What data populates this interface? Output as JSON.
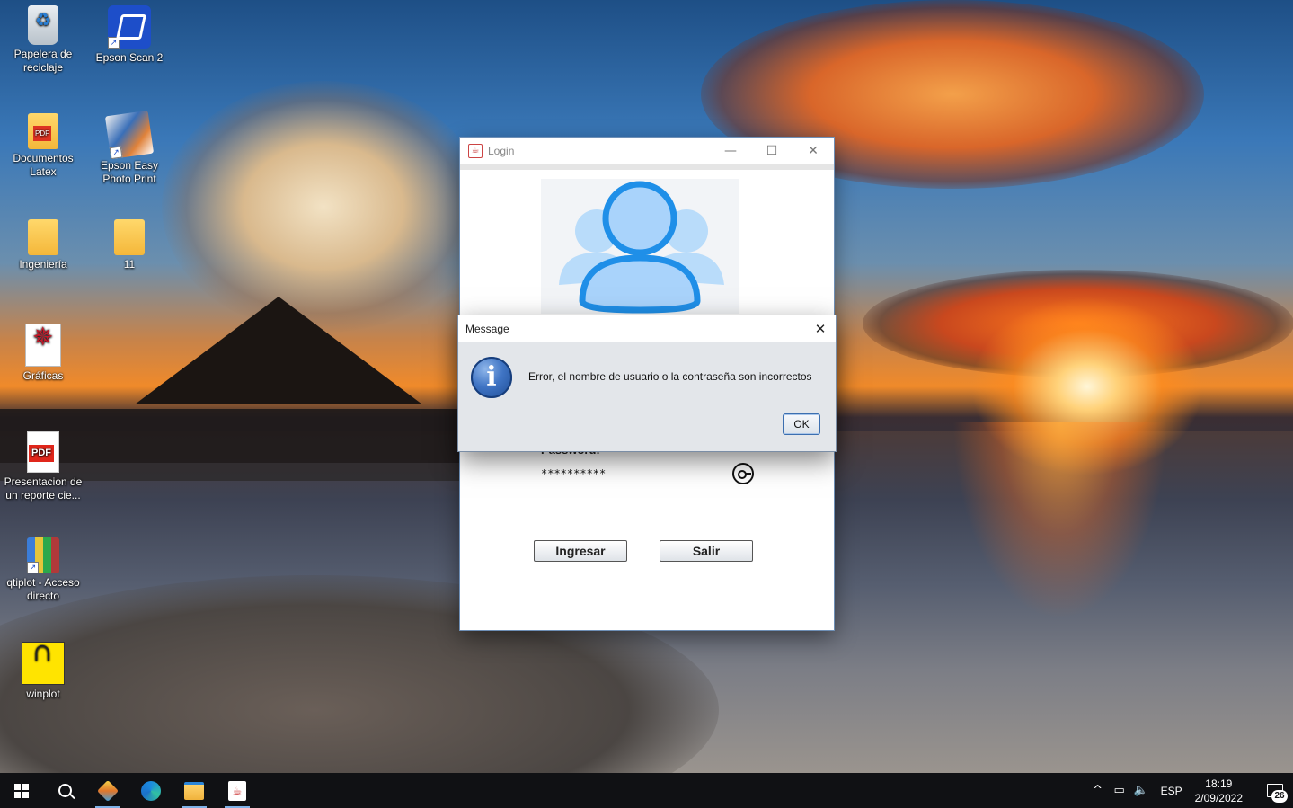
{
  "desktop": {
    "icons": [
      {
        "label": "Papelera de\nreciclaje",
        "icon": "recycle-bin-icon"
      },
      {
        "label": "Epson Scan 2",
        "icon": "epson-scan-icon"
      },
      {
        "label": "Documentos\nLatex",
        "icon": "folder-icon"
      },
      {
        "label": "Epson Easy\nPhoto Print",
        "icon": "photo-print-icon"
      },
      {
        "label": "Ingeniería",
        "icon": "folder-icon"
      },
      {
        "label": "11",
        "icon": "folder-icon"
      },
      {
        "label": "Gráficas",
        "icon": "graficas-icon"
      },
      {
        "label": "Presentacion de\nun reporte cie...",
        "icon": "pdf-icon"
      },
      {
        "label": "qtiplot - Acceso\ndirecto",
        "icon": "qtiplot-icon"
      },
      {
        "label": "winplot",
        "icon": "winplot-icon"
      }
    ]
  },
  "login_window": {
    "title": "Login",
    "password_label": "Password:",
    "password_value": "**********",
    "btn_ingresar": "Ingresar",
    "btn_salir": "Salir",
    "minimize": "—",
    "maximize": "☐",
    "close": "✕"
  },
  "message_dialog": {
    "title": "Message",
    "close": "✕",
    "icon_letter": "i",
    "text": "Error, el nombre de usuario o la contraseña son incorrectos",
    "ok": "OK"
  },
  "taskbar": {
    "tray_language": "ESP",
    "time": "18:19",
    "date": "2/09/2022",
    "notifications_count": "26",
    "chevron": "^",
    "network": "▭",
    "volume": "🔈"
  },
  "colors": {
    "taskbar_bg": "#101114",
    "dialog_bg": "#e3e6ea",
    "avatar_blue": "#1f8fe8"
  }
}
